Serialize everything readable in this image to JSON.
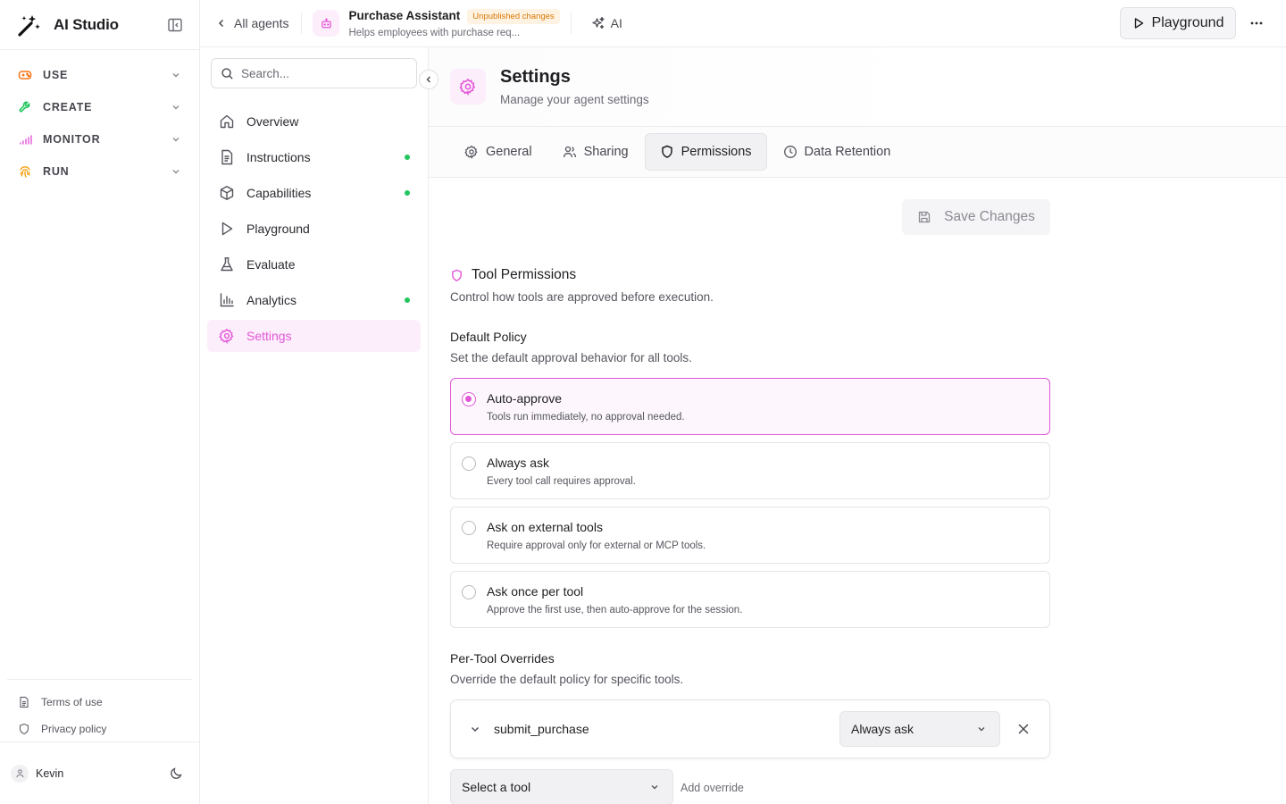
{
  "app": {
    "name": "AI Studio",
    "accent": "#e256d7"
  },
  "sidebar": {
    "groups": [
      {
        "label": "USE",
        "icon": "gamepad-icon",
        "color": "#f97316"
      },
      {
        "label": "CREATE",
        "icon": "wrench-icon",
        "color": "#22c55e"
      },
      {
        "label": "MONITOR",
        "icon": "signal-bars-icon",
        "color": "#e256d7"
      },
      {
        "label": "RUN",
        "icon": "fingerprint-icon",
        "color": "#f59e0b"
      }
    ],
    "footer": {
      "terms": "Terms of use",
      "privacy": "Privacy policy"
    },
    "user": {
      "name": "Kevin"
    }
  },
  "topbar": {
    "back_label": "All agents",
    "agent_name": "Purchase Assistant",
    "badge": "Unpublished changes",
    "agent_desc": "Helps employees with purchase req...",
    "ai_label": "AI",
    "playground_label": "Playground"
  },
  "subnav": {
    "search_placeholder": "Search...",
    "items": [
      {
        "label": "Overview",
        "dot": false
      },
      {
        "label": "Instructions",
        "dot": true
      },
      {
        "label": "Capabilities",
        "dot": true
      },
      {
        "label": "Playground",
        "dot": false
      },
      {
        "label": "Evaluate",
        "dot": false
      },
      {
        "label": "Analytics",
        "dot": true
      },
      {
        "label": "Settings",
        "dot": false,
        "active": true
      }
    ]
  },
  "page": {
    "title": "Settings",
    "subtitle": "Manage your agent settings",
    "tabs": [
      "General",
      "Sharing",
      "Permissions",
      "Data Retention"
    ],
    "active_tab": "Permissions",
    "save_label": "Save Changes",
    "tool_permissions": {
      "title": "Tool Permissions",
      "desc": "Control how tools are approved before execution."
    },
    "default_policy": {
      "title": "Default Policy",
      "desc": "Set the default approval behavior for all tools.",
      "options": [
        {
          "title": "Auto-approve",
          "desc": "Tools run immediately, no approval needed.",
          "selected": true
        },
        {
          "title": "Always ask",
          "desc": "Every tool call requires approval.",
          "selected": false
        },
        {
          "title": "Ask on external tools",
          "desc": "Require approval only for external or MCP tools.",
          "selected": false
        },
        {
          "title": "Ask once per tool",
          "desc": "Approve the first use, then auto-approve for the session.",
          "selected": false
        }
      ]
    },
    "overrides": {
      "title": "Per-Tool Overrides",
      "desc": "Override the default policy for specific tools.",
      "rows": [
        {
          "tool": "submit_purchase",
          "policy": "Always ask"
        }
      ],
      "select_placeholder": "Select a tool",
      "add_label": "Add override"
    }
  }
}
